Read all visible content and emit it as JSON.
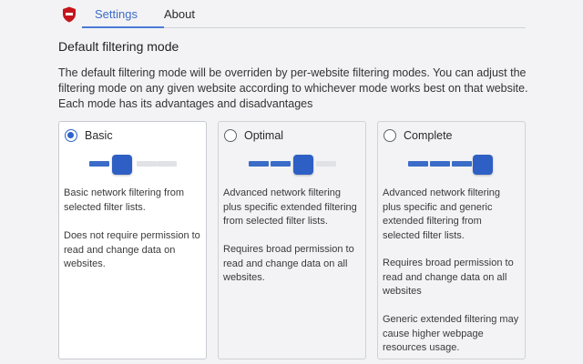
{
  "tabs": [
    {
      "label": "Settings",
      "active": true
    },
    {
      "label": "About",
      "active": false
    }
  ],
  "section_title": "Default filtering mode",
  "description": "The default filtering mode will be overriden by per-website filtering modes. You can adjust the filtering mode on any given website according to whichever mode works best on that website. Each mode has its advantages and disadvantages",
  "modes": [
    {
      "label": "Basic",
      "selected": true,
      "level": 1,
      "paragraphs": [
        "Basic network filtering from selected filter lists.",
        "Does not require permission to read and change data on websites."
      ]
    },
    {
      "label": "Optimal",
      "selected": false,
      "level": 2,
      "paragraphs": [
        "Advanced network filtering plus specific extended filtering from selected filter lists.",
        "Requires broad permission to read and change data on all websites."
      ]
    },
    {
      "label": "Complete",
      "selected": false,
      "level": 3,
      "paragraphs": [
        "Advanced network filtering plus specific and generic extended filtering from selected filter lists.",
        "Requires broad permission to read and change data on all websites",
        "Generic extended filtering may cause higher webpage resources usage."
      ]
    }
  ],
  "colors": {
    "accent": "#2f63c9",
    "slider_on": "#3a6cc8",
    "slider_off": "#e0e2e6",
    "logo_red": "#c4161c"
  },
  "icons": {
    "logo": "shield-logo-icon"
  }
}
